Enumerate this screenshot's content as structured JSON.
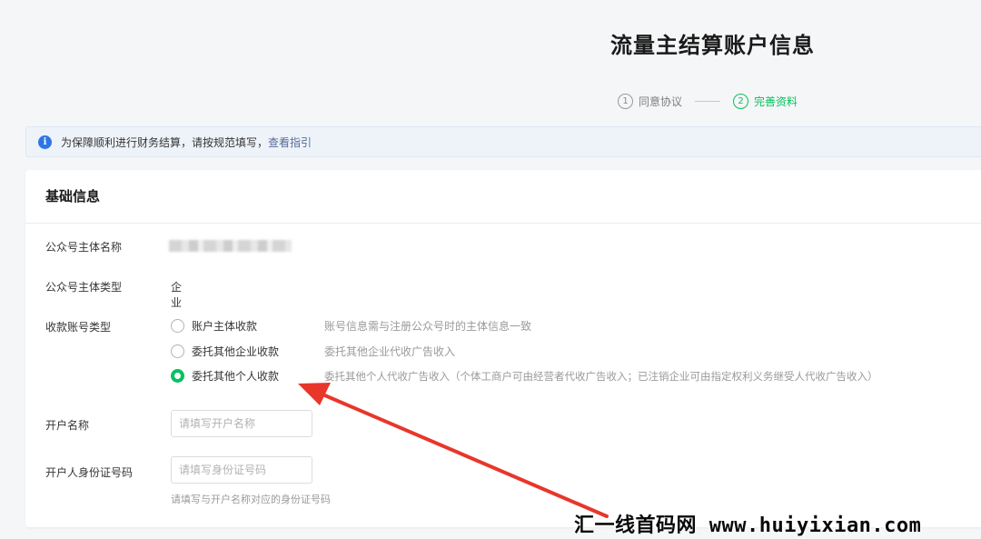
{
  "header": {
    "title": "流量主结算账户信息",
    "steps": [
      {
        "num": "1",
        "label": "同意协议"
      },
      {
        "num": "2",
        "label": "完善资料"
      }
    ]
  },
  "notice": {
    "text": "为保障顺利进行财务结算，请按规范填写，",
    "link": "查看指引"
  },
  "card": {
    "title": "基础信息",
    "fields": {
      "entity_name_label": "公众号主体名称",
      "entity_type_label": "公众号主体类型",
      "entity_type_value": "企业",
      "account_type_label": "收款账号类型",
      "account_name_label": "开户名称",
      "account_name_placeholder": "请填写开户名称",
      "id_label": "开户人身份证号码",
      "id_placeholder": "请填写身份证号码",
      "id_hint": "请填写与开户名称对应的身份证号码"
    },
    "options": [
      {
        "label": "账户主体收款",
        "desc": "账号信息需与注册公众号时的主体信息一致",
        "checked": false
      },
      {
        "label": "委托其他企业收款",
        "desc": "委托其他企业代收广告收入",
        "checked": false
      },
      {
        "label": "委托其他个人收款",
        "desc": "委托其他个人代收广告收入（个体工商户可由经营者代收广告收入；已注销企业可由指定权利义务继受人代收广告收入）",
        "checked": true
      }
    ]
  },
  "watermark": "汇一线首码网 www.huiyixian.com",
  "colors": {
    "accent": "#07c160",
    "link": "#576b95",
    "info": "#2d76e5",
    "arrow": "#e8362b"
  }
}
